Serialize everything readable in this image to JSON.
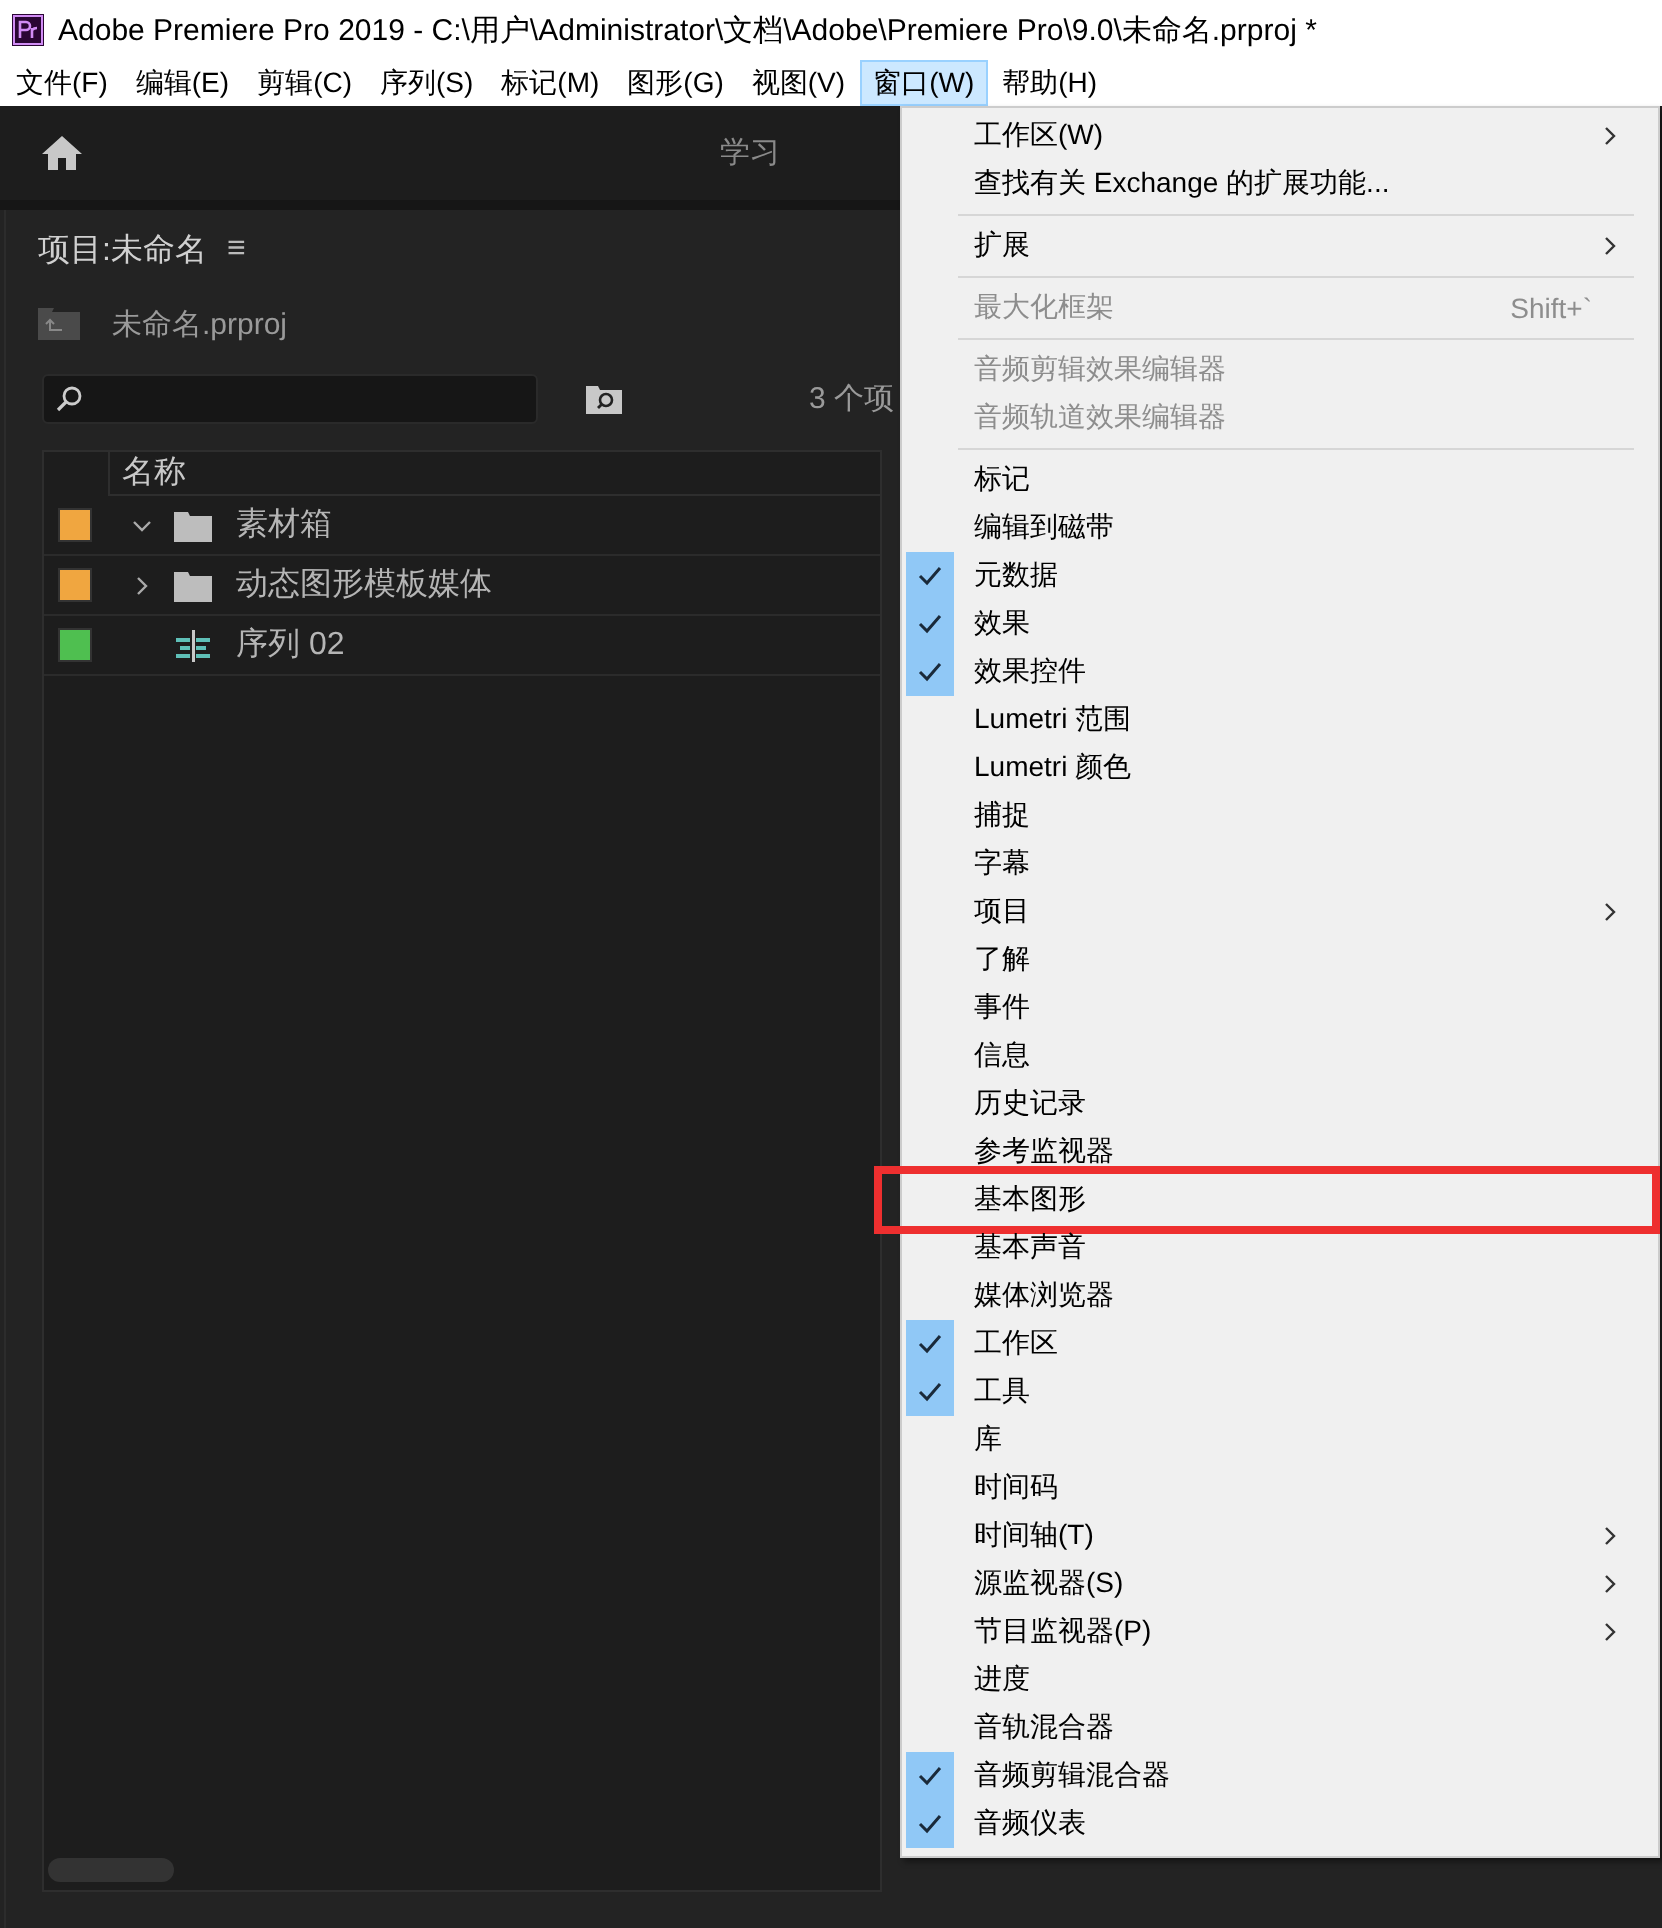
{
  "window": {
    "title": "Adobe Premiere Pro 2019 - C:\\用户\\Administrator\\文档\\Adobe\\Premiere Pro\\9.0\\未命名.prproj *"
  },
  "menubar": [
    {
      "label": "文件(F)",
      "selected": false
    },
    {
      "label": "编辑(E)",
      "selected": false
    },
    {
      "label": "剪辑(C)",
      "selected": false
    },
    {
      "label": "序列(S)",
      "selected": false
    },
    {
      "label": "标记(M)",
      "selected": false
    },
    {
      "label": "图形(G)",
      "selected": false
    },
    {
      "label": "视图(V)",
      "selected": false
    },
    {
      "label": "窗口(W)",
      "selected": true
    },
    {
      "label": "帮助(H)",
      "selected": false
    }
  ],
  "header_bar": {
    "tab": "学习"
  },
  "project_panel": {
    "title": "项目:未命名",
    "menu_glyph": "≡",
    "file": "未命名.prproj",
    "item_count": "3 个项",
    "column": "名称",
    "rows": [
      {
        "kind": "bin",
        "name": "素材箱",
        "color": "#f0a640",
        "expanded": true
      },
      {
        "kind": "bin",
        "name": "动态图形模板媒体",
        "color": "#f0a640",
        "expanded": false
      },
      {
        "kind": "sequence",
        "name": "序列 02",
        "color": "#4fbf50"
      }
    ]
  },
  "window_menu": [
    {
      "kind": "item",
      "label": "工作区(W)",
      "checked": false,
      "disabled": false,
      "submenu": true,
      "highlighted": false
    },
    {
      "kind": "item",
      "label": "查找有关 Exchange 的扩展功能...",
      "checked": false,
      "disabled": false,
      "submenu": false,
      "highlighted": false
    },
    {
      "kind": "separator"
    },
    {
      "kind": "item",
      "label": "扩展",
      "checked": false,
      "disabled": false,
      "submenu": true,
      "highlighted": false
    },
    {
      "kind": "separator"
    },
    {
      "kind": "item",
      "label": "最大化框架",
      "shortcut": "Shift+`",
      "checked": false,
      "disabled": true,
      "submenu": false,
      "highlighted": false
    },
    {
      "kind": "separator"
    },
    {
      "kind": "item",
      "label": "音频剪辑效果编辑器",
      "checked": false,
      "disabled": true,
      "submenu": false,
      "highlighted": false
    },
    {
      "kind": "item",
      "label": "音频轨道效果编辑器",
      "checked": false,
      "disabled": true,
      "submenu": false,
      "highlighted": false
    },
    {
      "kind": "separator"
    },
    {
      "kind": "item",
      "label": "标记",
      "checked": false,
      "disabled": false,
      "submenu": false,
      "highlighted": false
    },
    {
      "kind": "item",
      "label": "编辑到磁带",
      "checked": false,
      "disabled": false,
      "submenu": false,
      "highlighted": false
    },
    {
      "kind": "item",
      "label": "元数据",
      "checked": true,
      "disabled": false,
      "submenu": false,
      "highlighted": false
    },
    {
      "kind": "item",
      "label": "效果",
      "checked": true,
      "disabled": false,
      "submenu": false,
      "highlighted": false
    },
    {
      "kind": "item",
      "label": "效果控件",
      "checked": true,
      "disabled": false,
      "submenu": false,
      "highlighted": false
    },
    {
      "kind": "item",
      "label": "Lumetri 范围",
      "checked": false,
      "disabled": false,
      "submenu": false,
      "highlighted": false
    },
    {
      "kind": "item",
      "label": "Lumetri 颜色",
      "checked": false,
      "disabled": false,
      "submenu": false,
      "highlighted": false
    },
    {
      "kind": "item",
      "label": "捕捉",
      "checked": false,
      "disabled": false,
      "submenu": false,
      "highlighted": false
    },
    {
      "kind": "item",
      "label": "字幕",
      "checked": false,
      "disabled": false,
      "submenu": false,
      "highlighted": false
    },
    {
      "kind": "item",
      "label": "项目",
      "checked": false,
      "disabled": false,
      "submenu": true,
      "highlighted": false
    },
    {
      "kind": "item",
      "label": "了解",
      "checked": false,
      "disabled": false,
      "submenu": false,
      "highlighted": false
    },
    {
      "kind": "item",
      "label": "事件",
      "checked": false,
      "disabled": false,
      "submenu": false,
      "highlighted": false
    },
    {
      "kind": "item",
      "label": "信息",
      "checked": false,
      "disabled": false,
      "submenu": false,
      "highlighted": false
    },
    {
      "kind": "item",
      "label": "历史记录",
      "checked": false,
      "disabled": false,
      "submenu": false,
      "highlighted": false
    },
    {
      "kind": "item",
      "label": "参考监视器",
      "checked": false,
      "disabled": false,
      "submenu": false,
      "highlighted": false
    },
    {
      "kind": "item",
      "label": "基本图形",
      "checked": false,
      "disabled": false,
      "submenu": false,
      "highlighted": true
    },
    {
      "kind": "item",
      "label": "基本声音",
      "checked": false,
      "disabled": false,
      "submenu": false,
      "highlighted": false
    },
    {
      "kind": "item",
      "label": "媒体浏览器",
      "checked": false,
      "disabled": false,
      "submenu": false,
      "highlighted": false
    },
    {
      "kind": "item",
      "label": "工作区",
      "checked": true,
      "disabled": false,
      "submenu": false,
      "highlighted": false
    },
    {
      "kind": "item",
      "label": "工具",
      "checked": true,
      "disabled": false,
      "submenu": false,
      "highlighted": false
    },
    {
      "kind": "item",
      "label": "库",
      "checked": false,
      "disabled": false,
      "submenu": false,
      "highlighted": false
    },
    {
      "kind": "item",
      "label": "时间码",
      "checked": false,
      "disabled": false,
      "submenu": false,
      "highlighted": false
    },
    {
      "kind": "item",
      "label": "时间轴(T)",
      "checked": false,
      "disabled": false,
      "submenu": true,
      "highlighted": false
    },
    {
      "kind": "item",
      "label": "源监视器(S)",
      "checked": false,
      "disabled": false,
      "submenu": true,
      "highlighted": false
    },
    {
      "kind": "item",
      "label": "节目监视器(P)",
      "checked": false,
      "disabled": false,
      "submenu": true,
      "highlighted": false
    },
    {
      "kind": "item",
      "label": "进度",
      "checked": false,
      "disabled": false,
      "submenu": false,
      "highlighted": false
    },
    {
      "kind": "item",
      "label": "音轨混合器",
      "checked": false,
      "disabled": false,
      "submenu": false,
      "highlighted": false
    },
    {
      "kind": "item",
      "label": "音频剪辑混合器",
      "checked": true,
      "disabled": false,
      "submenu": false,
      "highlighted": false
    },
    {
      "kind": "item",
      "label": "音频仪表",
      "checked": true,
      "disabled": false,
      "submenu": false,
      "highlighted": false
    }
  ]
}
